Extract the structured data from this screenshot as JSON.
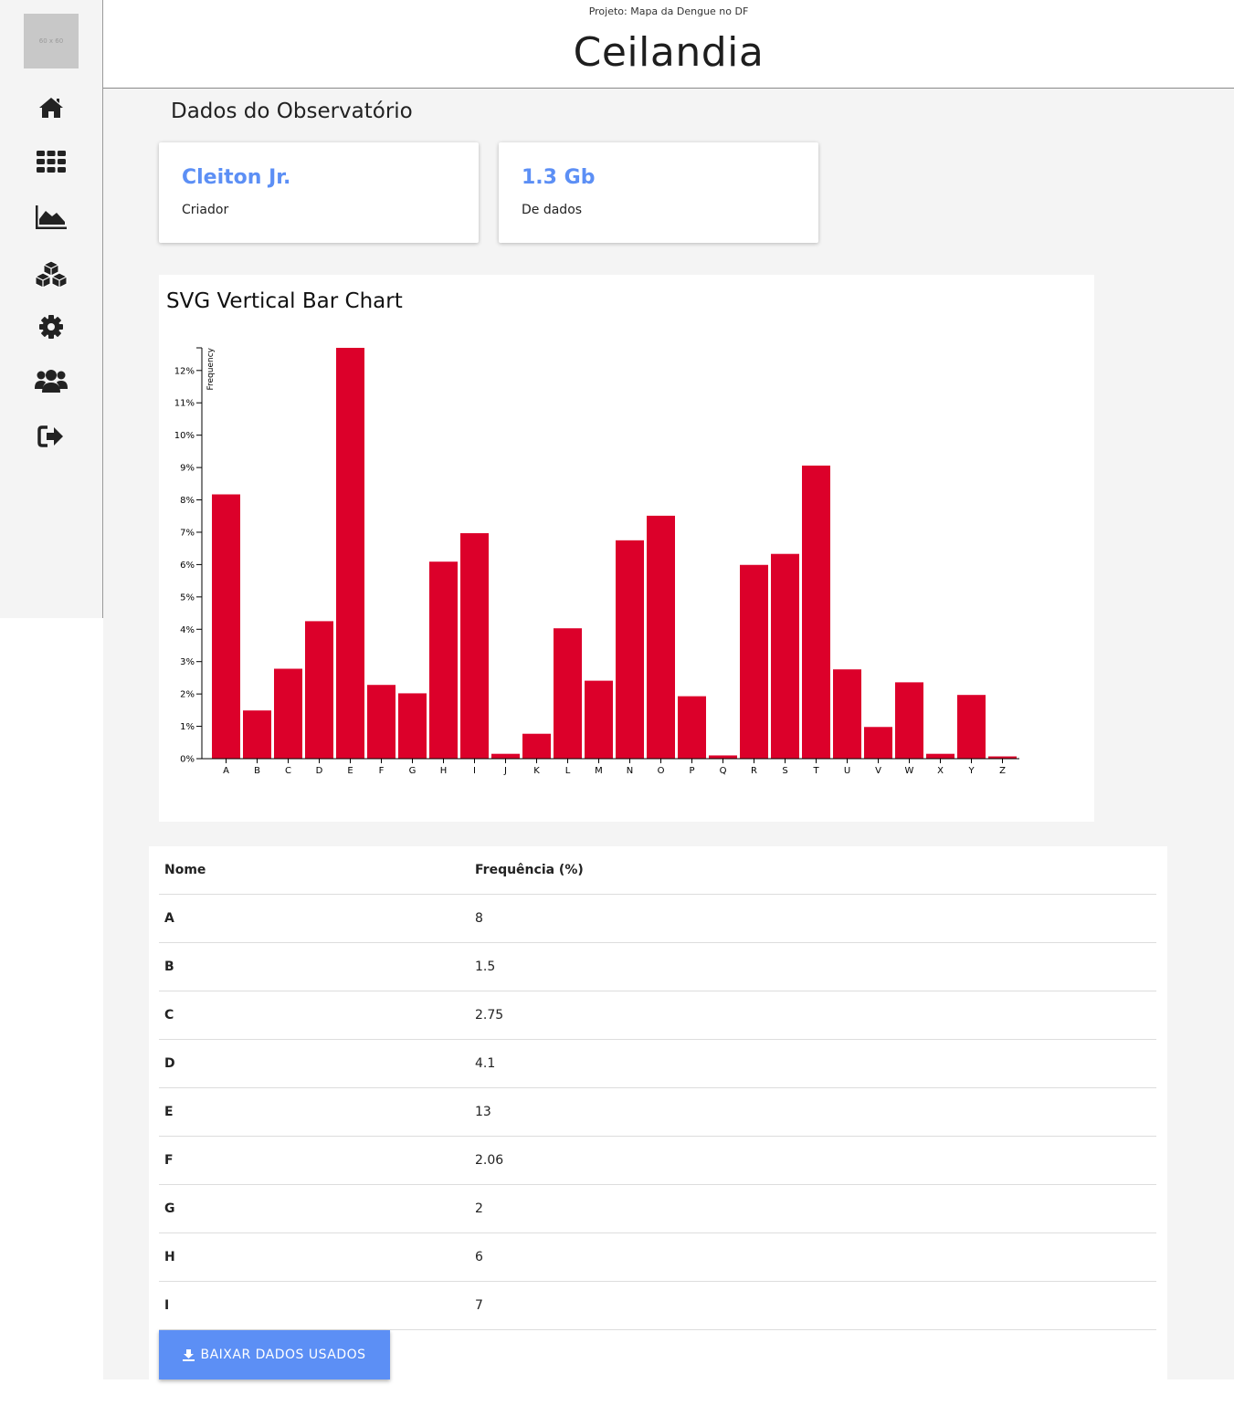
{
  "logo": {
    "text": "60 x 60"
  },
  "header": {
    "project": "Projeto: Mapa da Dengue no DF",
    "title": "Ceilandia"
  },
  "section": {
    "title": "Dados do Observatório"
  },
  "cards": [
    {
      "value": "Cleiton Jr.",
      "label": "Criador"
    },
    {
      "value": "1.3 Gb",
      "label": "De dados"
    }
  ],
  "chart_data": {
    "type": "bar",
    "title": "SVG Vertical Bar Chart",
    "ylabel": "Frequency",
    "xlabel": "",
    "categories": [
      "A",
      "B",
      "C",
      "D",
      "E",
      "F",
      "G",
      "H",
      "I",
      "J",
      "K",
      "L",
      "M",
      "N",
      "O",
      "P",
      "Q",
      "R",
      "S",
      "T",
      "U",
      "V",
      "W",
      "X",
      "Y",
      "Z"
    ],
    "values": [
      8.17,
      1.49,
      2.78,
      4.25,
      12.7,
      2.28,
      2.02,
      6.09,
      6.97,
      0.15,
      0.77,
      4.03,
      2.41,
      6.75,
      7.51,
      1.93,
      0.1,
      5.99,
      6.33,
      9.06,
      2.76,
      0.98,
      2.36,
      0.15,
      1.97,
      0.07
    ],
    "yticks": [
      "0%",
      "1%",
      "2%",
      "3%",
      "4%",
      "5%",
      "6%",
      "7%",
      "8%",
      "9%",
      "10%",
      "11%",
      "12%"
    ],
    "ylim": [
      0,
      12.7
    ],
    "color": "#dc002a",
    "grid": false
  },
  "table": {
    "headers": [
      "Nome",
      "Frequência (%)"
    ],
    "rows": [
      [
        "A",
        "8"
      ],
      [
        "B",
        "1.5"
      ],
      [
        "C",
        "2.75"
      ],
      [
        "D",
        "4.1"
      ],
      [
        "E",
        "13"
      ],
      [
        "F",
        "2.06"
      ],
      [
        "G",
        "2"
      ],
      [
        "H",
        "6"
      ],
      [
        "I",
        "7"
      ]
    ]
  },
  "download": {
    "label": "BAIXAR DADOS USADOS"
  },
  "icons": [
    "home-icon",
    "grid-icon",
    "area-chart-icon",
    "cubes-icon",
    "gear-icon",
    "users-icon",
    "sign-out-icon"
  ]
}
